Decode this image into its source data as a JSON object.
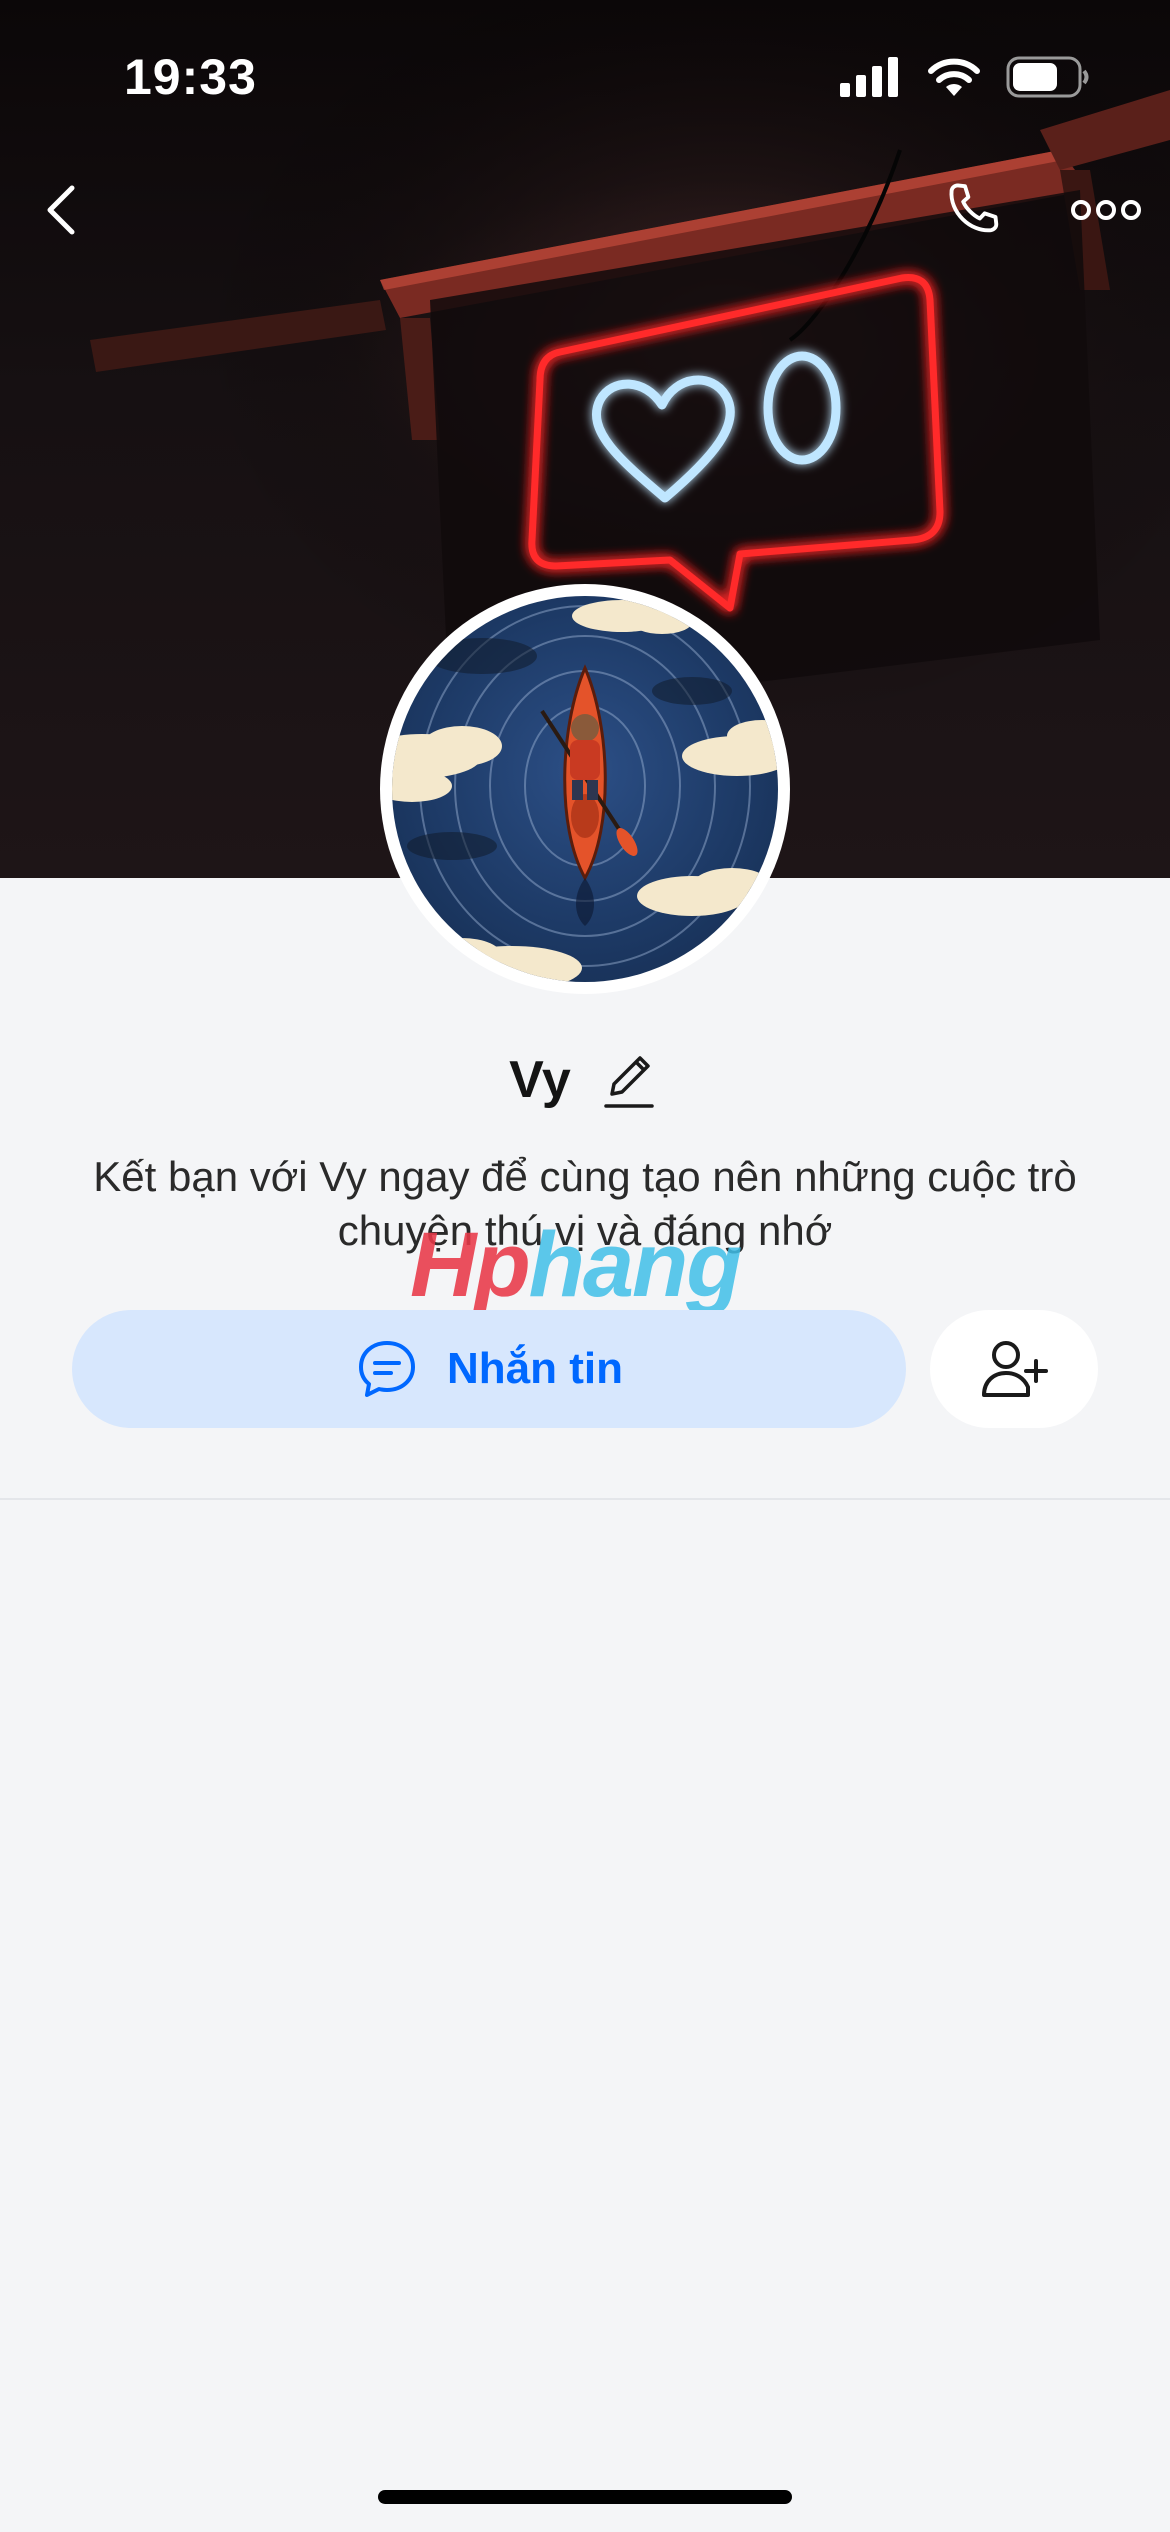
{
  "status_bar": {
    "time": "19:33"
  },
  "top_nav": {
    "back_icon": "chevron-left-icon",
    "call_icon": "phone-icon",
    "more_icon": "more-horizontal-icon"
  },
  "profile": {
    "name": "Vy",
    "bio": "Kết bạn với Vy ngay để cùng tạo nên những cuộc trò chuyện thú vị và đáng nhớ"
  },
  "actions": {
    "message_label": "Nhắn tin",
    "message_icon": "chat-bubble-icon",
    "add_friend_icon": "add-friend-icon"
  },
  "watermark": {
    "part1": "Hp",
    "part2": "hang"
  },
  "colors": {
    "accent": "#0068ff",
    "message_button_bg": "#d7e7fd",
    "page_bg": "#f4f5f7",
    "neon_red": "#ff2a2a",
    "neon_blue": "#bfe6ff"
  }
}
